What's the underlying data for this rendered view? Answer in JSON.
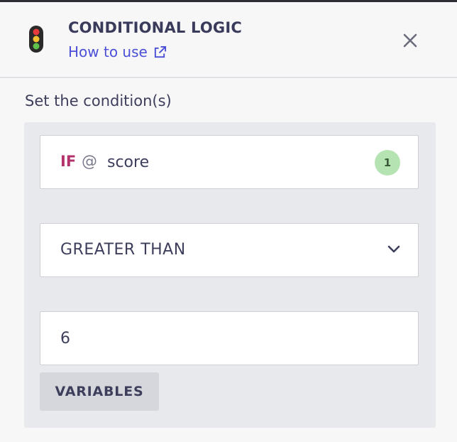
{
  "header": {
    "title": "CONDITIONAL LOGIC",
    "help_link": "How to use",
    "icon": "traffic-light-icon",
    "close_icon": "close-icon",
    "link_icon": "external-link-icon",
    "link_color": "#4b4fd8"
  },
  "section": {
    "label": "Set the condition(s)"
  },
  "condition": {
    "if_keyword": "IF",
    "at_symbol": "@",
    "variable": "score",
    "count": "1",
    "operator": "GREATER THAN",
    "value": "6",
    "variables_button": "VARIABLES",
    "keyword_color": "#b3326b",
    "badge_color": "#b5e3b2"
  }
}
